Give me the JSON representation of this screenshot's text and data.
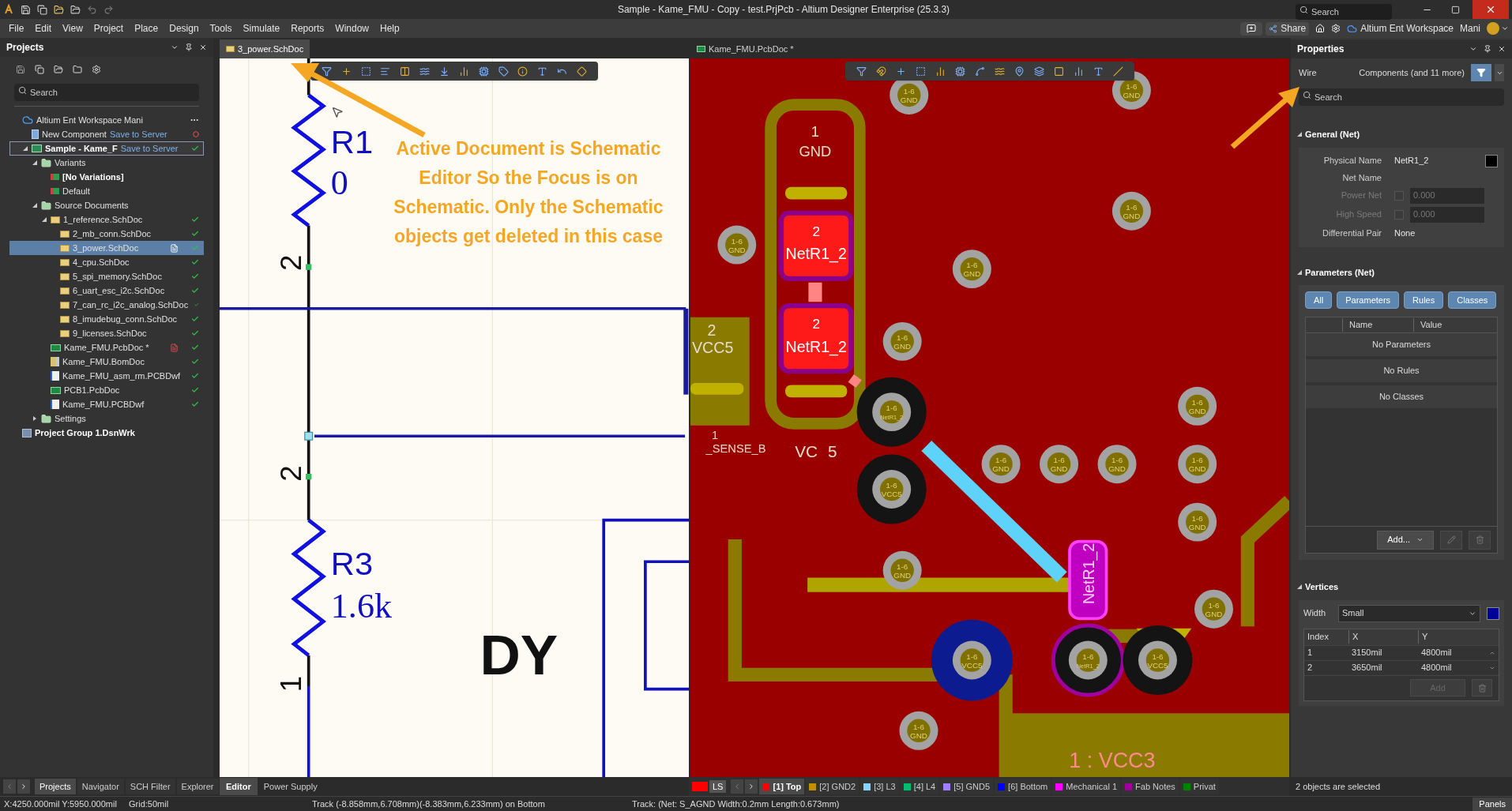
{
  "window": {
    "title": "Sample - Kame_FMU - Copy - test.PrjPcb - Altium Designer Enterprise (25.3.3)",
    "search_placeholder": "Search"
  },
  "menu": [
    "File",
    "Edit",
    "View",
    "Project",
    "Place",
    "Design",
    "Tools",
    "Simulate",
    "Reports",
    "Window",
    "Help"
  ],
  "account": {
    "share": "Share",
    "workspace": "Altium Ent Workspace",
    "user": "Mani"
  },
  "projects_panel": {
    "title": "Projects",
    "search_placeholder": "Search",
    "tree": [
      {
        "label": "Altium Ent Workspace  Mani",
        "kind": "cloud",
        "children": [
          {
            "label": "New Component",
            "kind": "component",
            "suffix": "Save to Server",
            "synced": false
          },
          {
            "label": "Sample - Kame_F",
            "kind": "project",
            "suffix": "Save to Server",
            "synced": true,
            "bold": true,
            "focused": true,
            "expanded": true,
            "children": [
              {
                "label": "Variants",
                "kind": "folder",
                "expanded": true,
                "children": [
                  {
                    "label": "[No Variations]",
                    "kind": "variant",
                    "bold": true
                  },
                  {
                    "label": "Default",
                    "kind": "variant"
                  }
                ]
              },
              {
                "label": "Source Documents",
                "kind": "folder",
                "expanded": true,
                "children": [
                  {
                    "label": "1_reference.SchDoc",
                    "kind": "schdoc",
                    "synced": true,
                    "expanded": true,
                    "children": [
                      {
                        "label": "2_mb_conn.SchDoc",
                        "kind": "schdoc",
                        "synced": true
                      },
                      {
                        "label": "3_power.SchDoc",
                        "kind": "schdoc",
                        "synced": true,
                        "selected": true,
                        "open": true,
                        "modified": false
                      },
                      {
                        "label": "4_cpu.SchDoc",
                        "kind": "schdoc",
                        "synced": true
                      },
                      {
                        "label": "5_spi_memory.SchDoc",
                        "kind": "schdoc",
                        "synced": true
                      },
                      {
                        "label": "6_uart_esc_i2c.SchDoc",
                        "kind": "schdoc",
                        "synced": true
                      },
                      {
                        "label": "7_can_rc_i2c_analog.SchDoc",
                        "kind": "schdoc",
                        "synced": true
                      },
                      {
                        "label": "8_imudebug_conn.SchDoc",
                        "kind": "schdoc",
                        "synced": true
                      },
                      {
                        "label": "9_licenses.SchDoc",
                        "kind": "schdoc",
                        "synced": true
                      }
                    ]
                  },
                  {
                    "label": "Kame_FMU.PcbDoc *",
                    "kind": "pcbdoc",
                    "synced": true,
                    "open": true,
                    "modified": true
                  },
                  {
                    "label": "Kame_FMU.BomDoc",
                    "kind": "bomdoc",
                    "synced": true
                  },
                  {
                    "label": "Kame_FMU_asm_rm.PCBDwf",
                    "kind": "pcbdwf",
                    "synced": true
                  },
                  {
                    "label": "PCB1.PcbDoc",
                    "kind": "pcbdoc",
                    "synced": true
                  },
                  {
                    "label": "Kame_FMU.PCBDwf",
                    "kind": "pcbdwf",
                    "synced": true
                  }
                ]
              },
              {
                "label": "Settings",
                "kind": "folder",
                "expanded": false
              }
            ]
          }
        ]
      },
      {
        "label": "Project Group 1.DsnWrk",
        "kind": "group",
        "bold": true
      }
    ]
  },
  "schematic": {
    "tab": {
      "label": "3_power.SchDoc",
      "selected": true
    },
    "components": [
      {
        "designator": "R1",
        "value": "0"
      },
      {
        "designator": "R3",
        "value": "1.6k"
      }
    ],
    "pin_numbers": [
      "2",
      "2",
      "1"
    ],
    "title_text": "DY",
    "annotation": "Active Document is Schematic Editor So the Focus is on Schematic. Only the Schematic objects get deleted in this case"
  },
  "pcb": {
    "tab": {
      "label": "Kame_FMU.PcbDoc *",
      "selected": false
    },
    "silk_labels": [
      "1",
      "GND",
      "2",
      "VCC5",
      "1",
      "_SENSE_B",
      "VC",
      "5",
      "1 : VCC3"
    ],
    "smd_pads": [
      {
        "number": "2",
        "net": "NetR1_2"
      },
      {
        "number": "2",
        "net": "NetR1_2"
      }
    ],
    "rotated_pad_net": "NetR1_2",
    "pads": [
      {
        "kind": "via",
        "layer": "1-6",
        "net": "GND"
      },
      {
        "kind": "via",
        "layer": "1-6",
        "net": "GND"
      },
      {
        "kind": "via",
        "layer": "1-6",
        "net": "GND"
      },
      {
        "kind": "via",
        "layer": "1-6",
        "net": "GND"
      },
      {
        "kind": "via",
        "layer": "1-6",
        "net": "GND"
      },
      {
        "kind": "via",
        "layer": "1-6",
        "net": "GND"
      },
      {
        "kind": "via",
        "layer": "1-6",
        "net": "GND"
      },
      {
        "kind": "via",
        "layer": "1-6",
        "net": "GND"
      },
      {
        "kind": "via",
        "layer": "1-6",
        "net": "GND"
      },
      {
        "kind": "via",
        "layer": "1-6",
        "net": "GND"
      },
      {
        "kind": "via",
        "layer": "1-6",
        "net": "GND"
      },
      {
        "kind": "via",
        "layer": "1-6",
        "net": "GND"
      },
      {
        "kind": "via",
        "layer": "1-6",
        "net": "GND"
      },
      {
        "kind": "via",
        "layer": "1-6",
        "net": "GND"
      },
      {
        "kind": "via",
        "layer": "1-6",
        "net": "GND"
      },
      {
        "kind": "black",
        "layer": "1-6",
        "net": "NetR1_2"
      },
      {
        "kind": "black",
        "layer": "1-6",
        "net": "VCC5"
      },
      {
        "kind": "blue",
        "layer": "1-6",
        "net": "VCC5"
      },
      {
        "kind": "black",
        "layer": "1-6",
        "net": "NetR1_2"
      },
      {
        "kind": "black",
        "layer": "1-6",
        "net": "VCC5"
      }
    ]
  },
  "properties": {
    "title": "Properties",
    "object": "Wire",
    "filter": "Components (and 11 more)",
    "search_placeholder": "Search",
    "general": {
      "title": "General (Net)",
      "physical_name": {
        "label": "Physical Name",
        "value": "NetR1_2",
        "color": "#000000"
      },
      "net_name": {
        "label": "Net Name"
      },
      "power_net": {
        "label": "Power Net",
        "value": "0.000",
        "disabled": true
      },
      "high_speed": {
        "label": "High Speed",
        "value": "0.000",
        "disabled": true
      },
      "diff_pair": {
        "label": "Differential Pair",
        "value": "None"
      }
    },
    "parameters": {
      "title": "Parameters (Net)",
      "filters": [
        {
          "label": "All",
          "selected": true
        },
        {
          "label": "Parameters",
          "selected": true
        },
        {
          "label": "Rules",
          "selected": true
        },
        {
          "label": "Classes",
          "selected": true
        }
      ],
      "columns": [
        "Name",
        "Value"
      ],
      "rows": [
        "No Parameters",
        "No Rules",
        "No Classes"
      ],
      "add_button": "Add..."
    },
    "vertices": {
      "title": "Vertices",
      "width_label": "Width",
      "width_value": "Small",
      "color": "#000099",
      "columns": [
        "Index",
        "X",
        "Y"
      ],
      "rows": [
        [
          "1",
          "3150mil",
          "4800mil"
        ],
        [
          "2",
          "3650mil",
          "4800mil"
        ]
      ],
      "add_button": {
        "label": "Add",
        "disabled": true
      }
    }
  },
  "bottom": {
    "panel_tabs": [
      {
        "label": "Projects",
        "selected": true
      },
      {
        "label": "Navigator",
        "selected": false
      },
      {
        "label": "SCH Filter",
        "selected": false
      },
      {
        "label": "Explorer",
        "selected": false
      }
    ],
    "editor_tabs": [
      {
        "label": "Editor",
        "selected": true
      },
      {
        "label": "Power Supply",
        "selected": false
      }
    ],
    "ls": "LS",
    "layers": [
      {
        "label": "[1] Top",
        "color": "#ff0000",
        "selected": true
      },
      {
        "label": "[2] GND2",
        "color": "#c09000",
        "selected": false
      },
      {
        "label": "[3] L3",
        "color": "#80d8ff",
        "selected": false
      },
      {
        "label": "[4] L4",
        "color": "#00c070",
        "selected": false
      },
      {
        "label": "[5] GND5",
        "color": "#a080ff",
        "selected": false
      },
      {
        "label": "[6] Bottom",
        "color": "#0000ff",
        "selected": false
      },
      {
        "label": "Mechanical 1",
        "color": "#ff00ff",
        "selected": false
      },
      {
        "label": "Fab Notes",
        "color": "#a000a0",
        "selected": false
      },
      {
        "label": "Privat",
        "color": "#008000",
        "selected": false
      }
    ],
    "selection_status": "2 objects are selected"
  },
  "status_bar": {
    "coords": "X:4250.000mil Y:5950.000mil",
    "grid": "Grid:50mil",
    "track": "Track (-8.858mm,6.708mm)(-8.383mm,6.233mm) on Bottom",
    "track_info": "Track: (Net: S_AGND Width:0.2mm Length:0.673mm)",
    "panels": "Panels"
  }
}
